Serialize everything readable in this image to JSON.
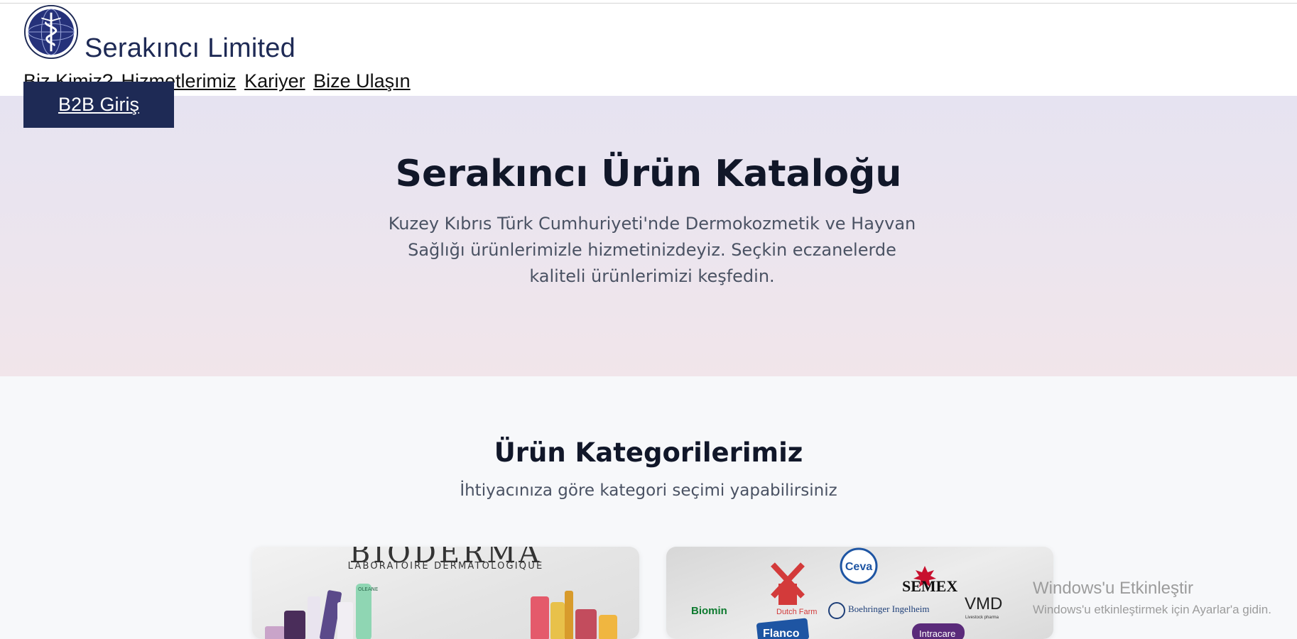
{
  "header": {
    "brand": "Serakıncı Limited",
    "nav": [
      "Biz Kimiz?",
      "Hizmetlerimiz",
      "Kariyer",
      "Bize Ulaşın"
    ],
    "b2b_label": "B2B Giriş"
  },
  "hero": {
    "title": "Serakıncı Ürün Kataloğu",
    "text": "Kuzey Kıbrıs Türk Cumhuriyeti'nde Dermokozmetik ve Hayvan Sağlığı ürünlerimizle hizmetinizdeyiz. Seçkin eczanelerde kaliteli ürünlerimizi keşfedin."
  },
  "categories": {
    "title": "Ürün Kategorilerimiz",
    "subtitle": "İhtiyacınıza göre kategori seçimi yapabilirsiniz",
    "bioderma": {
      "brand": "BIODERMA",
      "sub": "LABORATOIRE DERMATOLOGIQUE",
      "product_label": "OLEANE"
    },
    "animal_brands": {
      "ceva": "Ceva",
      "dutch_farm": "Dutch Farm",
      "semex": "SEMEX",
      "biomin": "Biomin",
      "boehringer": "Boehringer Ingelheim",
      "vmd": "VMD",
      "vmd_sub": "Livestock pharma",
      "flanco": "Flanco",
      "intracare": "Intracare"
    }
  },
  "watermark": {
    "title": "Windows'u Etkinleştir",
    "text": "Windows'u etkinleştirmek için Ayarlar'a gidin."
  },
  "colors": {
    "navy": "#1e2a55",
    "hero_bg": "#e6e3f1",
    "page_bg": "#f7f8fa"
  }
}
